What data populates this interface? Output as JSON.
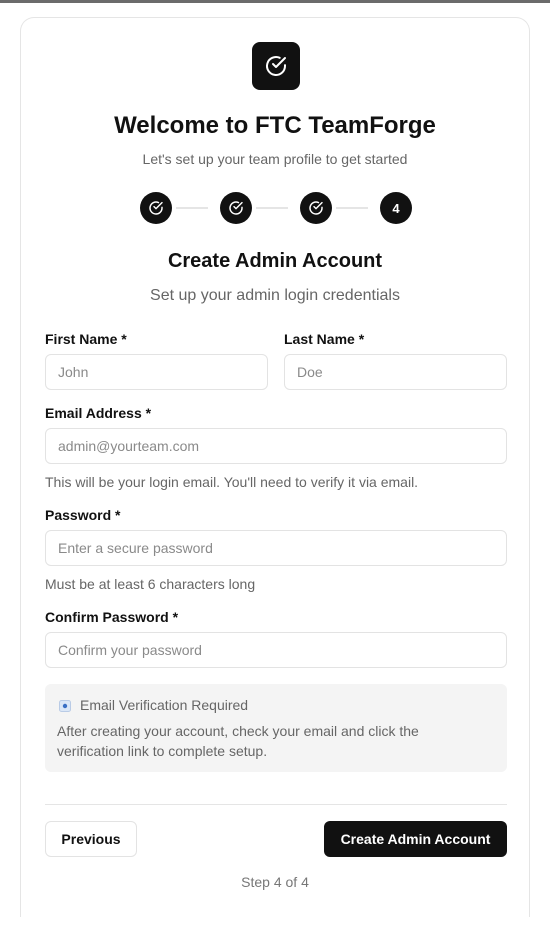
{
  "header": {
    "title": "Welcome to FTC TeamForge",
    "subtitle": "Let's set up your team profile to get started"
  },
  "stepper": {
    "steps": [
      {
        "state": "done",
        "icon": "check-circle-icon"
      },
      {
        "state": "done",
        "icon": "check-circle-icon"
      },
      {
        "state": "done",
        "icon": "check-circle-icon"
      },
      {
        "state": "current",
        "label": "4"
      }
    ]
  },
  "section": {
    "title": "Create Admin Account",
    "subtitle": "Set up your admin login credentials"
  },
  "form": {
    "first_name": {
      "label": "First Name *",
      "placeholder": "John",
      "value": ""
    },
    "last_name": {
      "label": "Last Name *",
      "placeholder": "Doe",
      "value": ""
    },
    "email": {
      "label": "Email Address *",
      "placeholder": "admin@yourteam.com",
      "value": "",
      "help": "This will be your login email. You'll need to verify it via email."
    },
    "password": {
      "label": "Password *",
      "placeholder": "Enter a secure password",
      "value": "",
      "help": "Must be at least 6 characters long"
    },
    "confirm_password": {
      "label": "Confirm Password *",
      "placeholder": "Confirm your password",
      "value": ""
    }
  },
  "notice": {
    "icon": "info-dot-icon",
    "title": "Email Verification Required",
    "body": "After creating your account, check your email and click the verification link to complete setup."
  },
  "actions": {
    "previous_label": "Previous",
    "create_label": "Create Admin Account"
  },
  "footer": {
    "step_text": "Step 4 of 4"
  },
  "colors": {
    "primary": "#111111",
    "muted_text": "#666666",
    "border": "#e3e3e3",
    "notice_bg": "#f4f4f4"
  }
}
